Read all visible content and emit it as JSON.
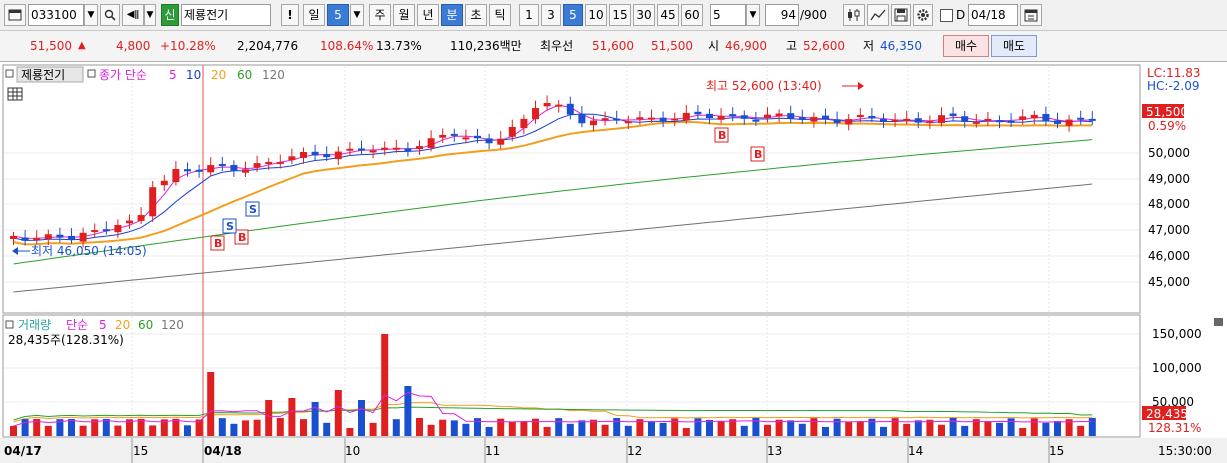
{
  "toolbar": {
    "stock_code": "033100",
    "stock_badge": "신",
    "stock_name": "제룡전기",
    "period_buttons": [
      "일",
      "5",
      "주",
      "월",
      "년",
      "분",
      "초",
      "틱"
    ],
    "selected_period": "분",
    "interval_buttons": [
      "1",
      "3",
      "5",
      "10",
      "15",
      "30",
      "45",
      "60"
    ],
    "selected_interval": "5",
    "interval_value": "5",
    "count_value": "94",
    "count_total": "/900",
    "date_prefix": "D",
    "date_value": "04/18"
  },
  "quote": {
    "price": "51,500",
    "change": "4,800",
    "change_pct": "+10.28%",
    "volume": "2,204,776",
    "volume_ratio": "108.64%",
    "turnover": "13.73%",
    "amount": "110,236백만",
    "best_ask_label": "최우선",
    "best_ask": "51,600",
    "best_bid": "51,500",
    "open_label": "시",
    "open": "46,900",
    "high_label": "고",
    "high": "52,600",
    "low_label": "저",
    "low": "46,350",
    "buy_button": "매수",
    "sell_button": "매도"
  },
  "price_panel": {
    "legend_name": "제룡전기",
    "legend_ma_label": "종가 단순",
    "ma_periods": [
      "5",
      "10",
      "20",
      "60",
      "120"
    ],
    "lc_label": "LC:11.83",
    "hc_label": "HC:-2.09",
    "current_price": "51,500",
    "current_pct": "0.59%",
    "high_annotation": "최고 52,600 (13:40)",
    "low_annotation": "최저 46,050 (14:05)",
    "y_ticks": [
      "50,000",
      "49,000",
      "48,000",
      "47,000",
      "46,000",
      "45,000"
    ]
  },
  "volume_panel": {
    "legend_label": "거래량",
    "legend_ma_label": "단순",
    "ma_periods": [
      "5",
      "20",
      "60",
      "120"
    ],
    "current_text": "28,435주(128.31%)",
    "y_ticks": [
      "150,000",
      "100,000",
      "50,000"
    ],
    "current_value": "28,435",
    "current_pct": "128.31%"
  },
  "x_axis": {
    "labels": [
      "04/17",
      "15",
      "04/18",
      "10",
      "11",
      "12",
      "13",
      "14",
      "15"
    ],
    "time_label": "15:30:00"
  },
  "colors": {
    "up": "#e02020",
    "down": "#1a4fd0",
    "ma5": "#e020e0",
    "ma10": "#1a3fd0",
    "ma20": "#f0a020",
    "ma60": "#2aa02a",
    "ma120": "#707070"
  },
  "chart_data": {
    "type": "candlestick",
    "price_series": [
      {
        "name": "종가 단순 5"
      },
      {
        "name": "종가 단순 10"
      },
      {
        "name": "종가 단순 20"
      },
      {
        "name": "종가 단순 60"
      },
      {
        "name": "종가 단순 120"
      }
    ],
    "last_price": 51500,
    "session_high": 52600,
    "session_low": 46050,
    "last_volume": 28435
  }
}
